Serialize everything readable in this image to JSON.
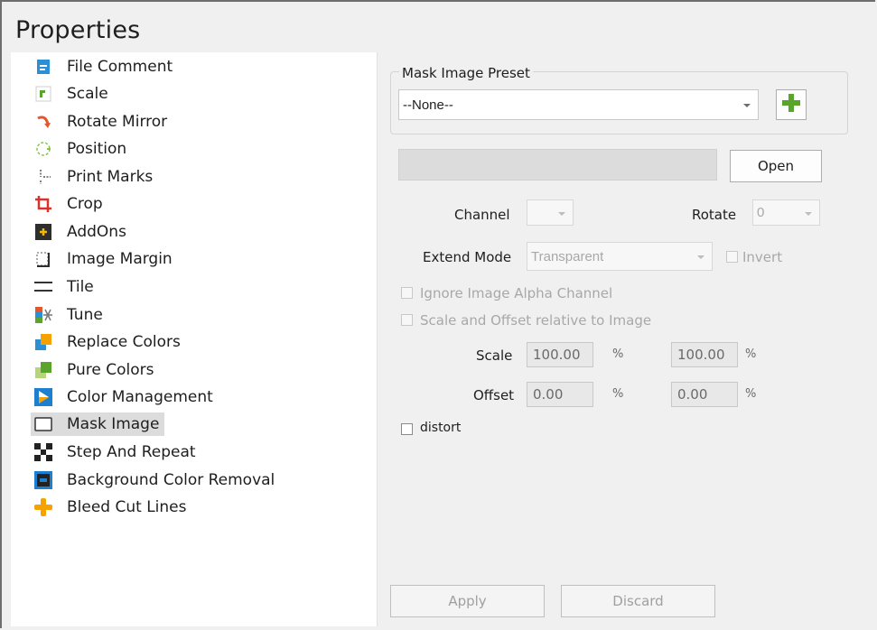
{
  "panel": {
    "title": "Properties"
  },
  "list": {
    "items": [
      {
        "label": "File Comment",
        "icon": "file-comment-icon"
      },
      {
        "label": "Scale",
        "icon": "scale-icon"
      },
      {
        "label": "Rotate Mirror",
        "icon": "rotate-mirror-icon"
      },
      {
        "label": "Position",
        "icon": "position-icon"
      },
      {
        "label": "Print Marks",
        "icon": "print-marks-icon"
      },
      {
        "label": "Crop",
        "icon": "crop-icon"
      },
      {
        "label": "AddOns",
        "icon": "addons-icon"
      },
      {
        "label": "Image Margin",
        "icon": "image-margin-icon"
      },
      {
        "label": "Tile",
        "icon": "tile-icon"
      },
      {
        "label": "Tune",
        "icon": "tune-icon"
      },
      {
        "label": "Replace Colors",
        "icon": "replace-colors-icon"
      },
      {
        "label": "Pure Colors",
        "icon": "pure-colors-icon"
      },
      {
        "label": "Color Management",
        "icon": "color-management-icon"
      },
      {
        "label": "Mask Image",
        "icon": "mask-image-icon",
        "selected": true
      },
      {
        "label": "Step And Repeat",
        "icon": "step-and-repeat-icon"
      },
      {
        "label": "Background Color Removal",
        "icon": "background-color-removal-icon"
      },
      {
        "label": "Bleed Cut Lines",
        "icon": "bleed-cut-lines-icon"
      }
    ]
  },
  "mask": {
    "preset_group_label": "Mask Image Preset",
    "preset_value": "--None--",
    "add_preset_icon": "plus-icon",
    "open_label": "Open",
    "channel_label": "Channel",
    "channel_value": "",
    "rotate_label": "Rotate",
    "rotate_value": "0",
    "extend_mode_label": "Extend Mode",
    "extend_mode_value": "Transparent",
    "invert_label": "Invert",
    "ignore_alpha_label": "Ignore Image Alpha Channel",
    "scale_offset_relative_label": "Scale and Offset relative to Image",
    "scale_label": "Scale",
    "scale_x": "100.00",
    "scale_y": "100.00",
    "offset_label": "Offset",
    "offset_x": "0.00",
    "offset_y": "0.00",
    "percent": "%",
    "distort_label": "distort",
    "apply_label": "Apply",
    "discard_label": "Discard"
  },
  "colors": {
    "accent_green": "#59a52c",
    "selected_bg": "#dcdcdc"
  }
}
